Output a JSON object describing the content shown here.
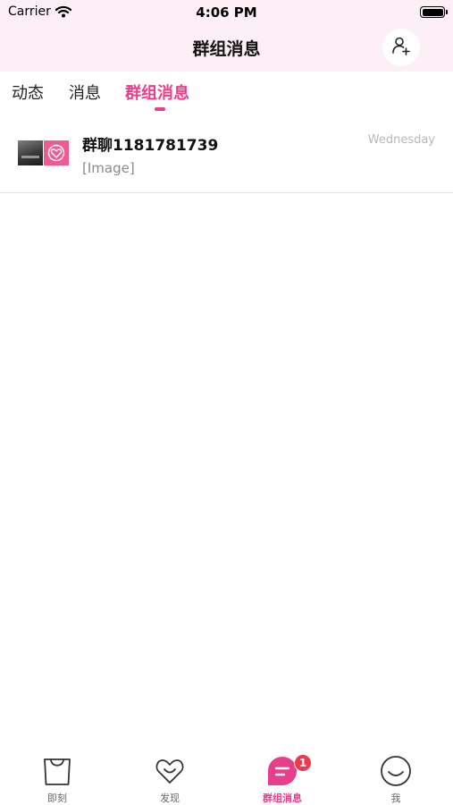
{
  "status_bar": {
    "carrier": "Carrier",
    "time": "4:06 PM"
  },
  "header": {
    "title": "群组消息",
    "add_friend_icon": "add-user-icon"
  },
  "tabs": [
    {
      "label": "动态",
      "active": false
    },
    {
      "label": "消息",
      "active": false
    },
    {
      "label": "群组消息",
      "active": true
    }
  ],
  "conversations": [
    {
      "name": "群聊1181781739",
      "preview": "[Image]",
      "time": "Wednesday",
      "avatars": [
        "photo-thumbnail",
        "heart-logo"
      ]
    }
  ],
  "tabbar": {
    "items": [
      {
        "label": "即刻",
        "icon": "shopping-bag-icon",
        "active": false
      },
      {
        "label": "发现",
        "icon": "heart-icon",
        "active": false
      },
      {
        "label": "群组消息",
        "icon": "chat-bubble-icon",
        "active": true,
        "badge": "1"
      },
      {
        "label": "我",
        "icon": "smiley-icon",
        "active": false
      }
    ]
  },
  "colors": {
    "accent": "#e83e8c",
    "header_bg": "#fdeff6",
    "badge": "#f0384b"
  }
}
